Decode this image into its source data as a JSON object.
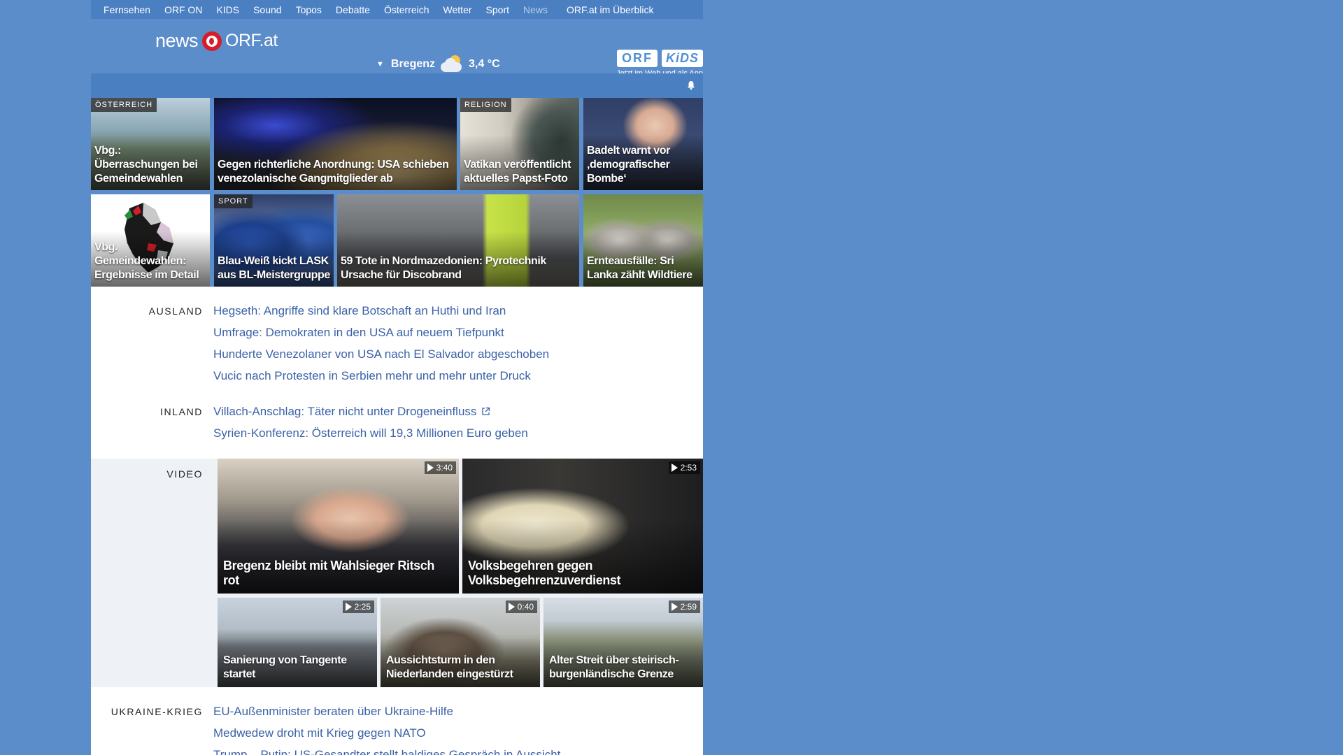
{
  "topnav": [
    {
      "label": "Fernsehen"
    },
    {
      "label": "ORF ON"
    },
    {
      "label": "KIDS"
    },
    {
      "label": "Sound"
    },
    {
      "label": "Topos"
    },
    {
      "label": "Debatte"
    },
    {
      "label": "Österreich"
    },
    {
      "label": "Wetter"
    },
    {
      "label": "Sport"
    },
    {
      "label": "News"
    },
    {
      "label": "ORF.at im Überblick"
    }
  ],
  "header": {
    "logo_news": "news",
    "logo_orfat": "ORF.at",
    "weather": {
      "city": "Bregenz",
      "temperature": "3,4 °C",
      "icon": "cloud-sun-icon"
    },
    "kids_promo": {
      "orf": "ORF",
      "kids": "KiDS",
      "tagline": "Jetzt im Web und als App"
    }
  },
  "teasers_row1": [
    {
      "category": "ÖSTERREICH",
      "title": "Vbg.: Überraschungen bei Gemeindewahlen"
    },
    {
      "category": "",
      "title": "Gegen richterliche Anordnung: USA schieben venezolanische Gangmitglieder ab"
    },
    {
      "category": "RELIGION",
      "title": "Vatikan veröffentlicht aktuelles Papst-Foto"
    },
    {
      "category": "",
      "title": "Badelt warnt vor ‚demografischer Bombe‘"
    }
  ],
  "teasers_row2": [
    {
      "category": "",
      "title": "Vbg. Gemeindewahlen: Ergebnisse im Detail"
    },
    {
      "category": "SPORT",
      "title": "Blau-Weiß kickt LASK aus BL-Meistergruppe"
    },
    {
      "category": "",
      "title": "59 Tote in Nordmazedonien: Pyrotechnik Ursache für Discobrand"
    },
    {
      "category": "",
      "title": "Ernteausfälle: Sri Lanka zählt Wildtiere"
    }
  ],
  "sections": {
    "ausland": {
      "label": "AUSLAND",
      "links": [
        "Hegseth: Angriffe sind klare Botschaft an Huthi und Iran",
        "Umfrage: Demokraten in den USA auf neuem Tiefpunkt",
        "Hunderte Venezolaner von USA nach El Salvador abgeschoben",
        "Vucic nach Protesten in Serbien mehr und mehr unter Druck"
      ]
    },
    "inland": {
      "label": "INLAND",
      "links": [
        "Villach-Anschlag: Täter nicht unter Drogeneinfluss",
        "Syrien-Konferenz: Österreich will 19,3 Millionen Euro geben"
      ]
    },
    "video": {
      "label": "VIDEO",
      "items": [
        {
          "title": "Bregenz bleibt mit Wahlsieger Ritsch rot",
          "duration": "3:40"
        },
        {
          "title": "Volksbegehren gegen Volksbegehrenzuverdienst",
          "duration": "2:53"
        },
        {
          "title": "Sanierung von Tangente startet",
          "duration": "2:25"
        },
        {
          "title": "Aussichtsturm in den Niederlanden eingestürzt",
          "duration": "0:40"
        },
        {
          "title": "Alter Streit über steirisch-burgenländische Grenze",
          "duration": "2:59"
        }
      ]
    },
    "ukraine": {
      "label": "UKRAINE-KRIEG",
      "links": [
        "EU-Außenminister beraten über Ukraine-Hilfe",
        "Medwedew droht mit Krieg gegen NATO",
        "Trump – Putin: US-Gesandter stellt baldiges Gespräch in Aussicht"
      ]
    }
  },
  "colors": {
    "background": "#5b8dca",
    "topnav": "#4a7fc2",
    "link": "#3a62a8",
    "orf_red": "#d61e2a"
  }
}
